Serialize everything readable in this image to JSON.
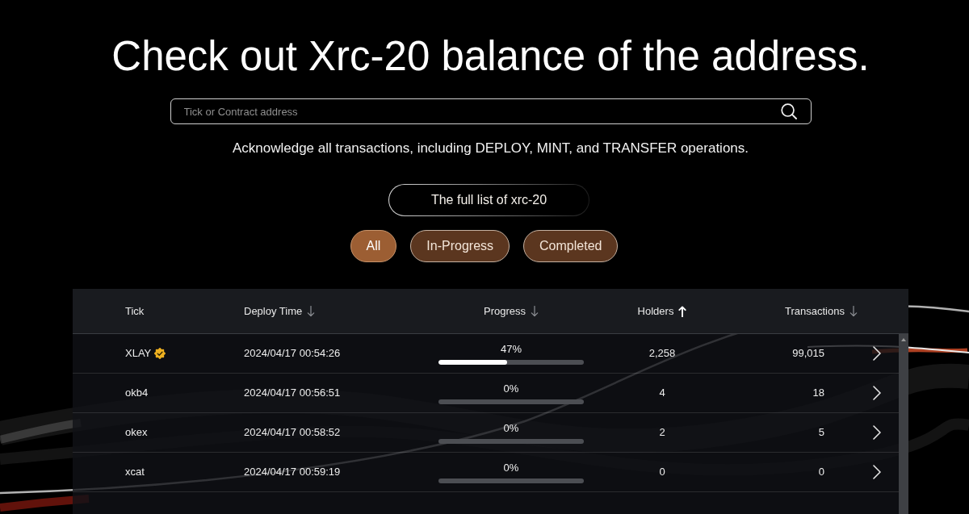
{
  "title": "Check out Xrc-20 balance of the address.",
  "search": {
    "placeholder": "Tick or Contract address"
  },
  "subtitle": "Acknowledge all transactions, including DEPLOY, MINT, and TRANSFER operations.",
  "list_heading": {
    "label": "The full list of xrc-20"
  },
  "filters": [
    {
      "label": "All",
      "selected": true
    },
    {
      "label": "In-Progress",
      "selected": false
    },
    {
      "label": "Completed",
      "selected": false
    }
  ],
  "table": {
    "columns": [
      {
        "label": "Tick"
      },
      {
        "label": "Deploy Time",
        "ascending": false,
        "active": false
      },
      {
        "label": "Progress",
        "ascending": false,
        "active": false
      },
      {
        "label": "Holders",
        "ascending": true,
        "active": true
      },
      {
        "label": "Transactions",
        "ascending": false,
        "active": false
      }
    ],
    "rows": [
      {
        "tick": "XLAY",
        "verified": true,
        "deploy_time": "2024/04/17 00:54:26",
        "progress": "47%",
        "level": 0.47,
        "holders": "2,258",
        "transactions": "99,015"
      },
      {
        "tick": "okb4",
        "verified": false,
        "deploy_time": "2024/04/17 00:56:51",
        "progress": "0%",
        "level": 0,
        "holders": "4",
        "transactions": "18"
      },
      {
        "tick": "okex",
        "verified": false,
        "deploy_time": "2024/04/17 00:58:52",
        "progress": "0%",
        "level": 0,
        "holders": "2",
        "transactions": "5"
      },
      {
        "tick": "xcat",
        "verified": false,
        "deploy_time": "2024/04/17 00:59:19",
        "progress": "0%",
        "level": 0,
        "holders": "0",
        "transactions": "0"
      }
    ]
  }
}
